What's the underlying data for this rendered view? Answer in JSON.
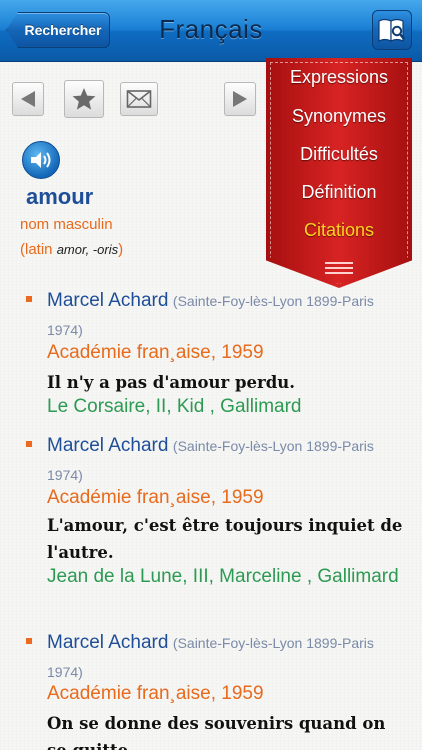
{
  "nav": {
    "back_label": "Rechercher",
    "title": "Français",
    "dict_icon": "dictionary-search-icon"
  },
  "toolbar": {
    "prev_icon": "arrow-left-icon",
    "favorite_icon": "star-icon",
    "mail_icon": "envelope-icon",
    "next_icon": "arrow-right-icon"
  },
  "entry": {
    "audio_icon": "speaker-icon",
    "headword": "amour",
    "pos": "nom masculin",
    "etym_prefix": "(latin ",
    "etym_latin": "amor, -oris",
    "etym_suffix": ")"
  },
  "menu": {
    "items": [
      "Expressions",
      "Synonymes",
      "Difficultés",
      "Définition",
      "Citations"
    ],
    "active": "Citations",
    "handle_icon": "menu-lines-icon"
  },
  "citations": [
    {
      "author": "Marcel Achard",
      "bio": "(Sainte-Foy-lès-Lyon 1899-Paris 1974)",
      "academy": "Académie fran¸aise, 1959",
      "quote": "Il n'y a pas d'amour perdu.",
      "source": "Le Corsaire, II, Kid , Gallimard"
    },
    {
      "author": "Marcel Achard",
      "bio": "(Sainte-Foy-lès-Lyon 1899-Paris 1974)",
      "academy": "Académie fran¸aise, 1959",
      "quote": "L'amour, c'est être toujours inquiet de l'autre.",
      "source": "Jean de la Lune, III, Marceline , Gallimard"
    },
    {
      "author": "Marcel Achard",
      "bio": "(Sainte-Foy-lès-Lyon 1899-Paris 1974)",
      "academy": "Académie fran¸aise, 1959",
      "quote": "On se donne des souvenirs quand on se quitte.",
      "source": ""
    }
  ],
  "colors": {
    "nav_blue": "#1a7fd4",
    "ribbon_red": "#d82323",
    "active_yellow": "#ffd21f",
    "author_blue": "#1e4e98",
    "accent_orange": "#e86a1c",
    "source_green": "#2c9a52"
  }
}
